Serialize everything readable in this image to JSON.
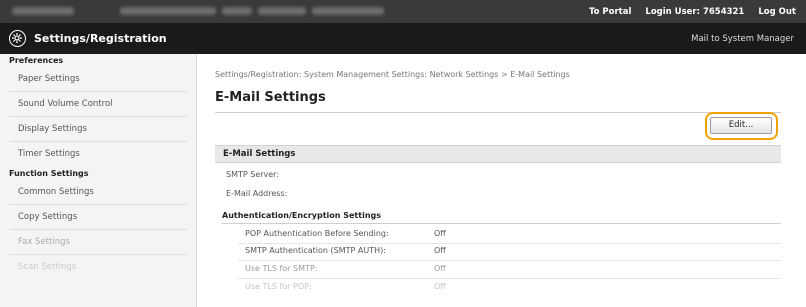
{
  "topbar": {
    "portal_link": "To Portal",
    "login_user": "Login User: 7654321",
    "logout": "Log Out"
  },
  "header": {
    "title": "Settings/Registration",
    "mail_link": "Mail to System Manager",
    "logo_icon": "settings-registration-icon"
  },
  "sidebar": {
    "sections": [
      {
        "title": "Preferences",
        "items": [
          "Paper Settings",
          "Sound Volume Control",
          "Display Settings",
          "Timer Settings"
        ]
      },
      {
        "title": "Function Settings",
        "items": [
          "Common Settings",
          "Copy Settings",
          "Fax Settings",
          "Scan Settings"
        ]
      }
    ]
  },
  "main": {
    "breadcrumb": "Settings/Registration: System Management Settings: Network Settings > E-Mail Settings",
    "title": "E-Mail Settings",
    "edit_button": "Edit...",
    "section_title": "E-Mail Settings",
    "fields": [
      "SMTP Server:",
      "E-Mail Address:"
    ],
    "auth_section_title": "Authentication/Encryption Settings",
    "auth_rows": [
      {
        "label": "POP Authentication Before Sending:",
        "value": "Off"
      },
      {
        "label": "SMTP Authentication (SMTP AUTH):",
        "value": "Off"
      },
      {
        "label": "Use TLS for SMTP:",
        "value": "Off"
      },
      {
        "label": "Use TLS for POP:",
        "value": "Off"
      }
    ]
  },
  "colors": {
    "topbar_bg": "#3a3a3a",
    "header_bg": "#1a1a1a",
    "highlight": "#f0a400",
    "section_bg": "#e8e8e8"
  }
}
